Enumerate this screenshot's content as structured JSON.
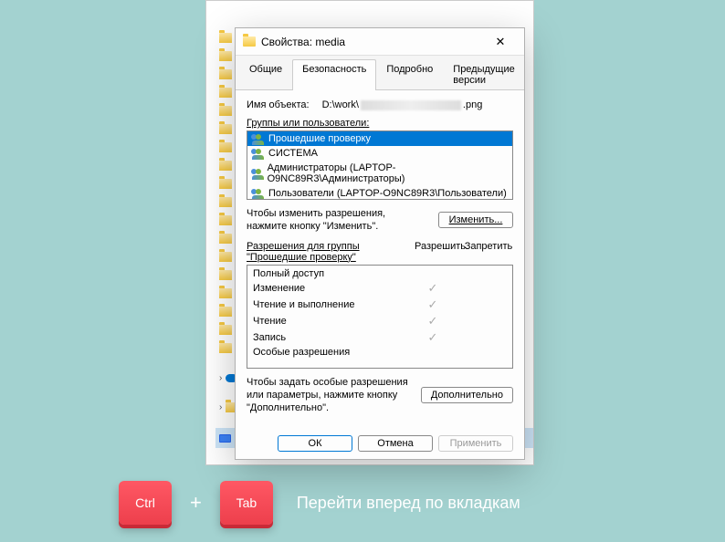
{
  "dialog": {
    "title": "Свойства: media",
    "tabs": [
      "Общие",
      "Безопасность",
      "Подробно",
      "Предыдущие версии"
    ],
    "active_tab": 1,
    "object_label": "Имя объекта:",
    "object_path_prefix": "D:\\work\\",
    "object_path_suffix": ".png",
    "groups_label": "Группы или пользователи:",
    "groups": [
      "Прошедшие проверку",
      "СИСТЕМА",
      "Администраторы (LAPTOP-O9NC89R3\\Администраторы)",
      "Пользователи (LAPTOP-O9NC89R3\\Пользователи)"
    ],
    "selected_group": 0,
    "change_help": "Чтобы изменить разрешения,\nнажмите кнопку \"Изменить\".",
    "change_btn": "Изменить...",
    "perm_header": "Разрешения для группы \"Прошедшие проверку\"",
    "perm_allow": "Разрешить",
    "perm_deny": "Запретить",
    "permissions": [
      {
        "name": "Полный доступ",
        "allow": false,
        "deny": false
      },
      {
        "name": "Изменение",
        "allow": true,
        "deny": false
      },
      {
        "name": "Чтение и выполнение",
        "allow": true,
        "deny": false
      },
      {
        "name": "Чтение",
        "allow": true,
        "deny": false
      },
      {
        "name": "Запись",
        "allow": true,
        "deny": false
      },
      {
        "name": "Особые разрешения",
        "allow": false,
        "deny": false
      }
    ],
    "advanced_help": "Чтобы задать особые разрешения или параметры, нажмите кнопку \"Дополнительно\".",
    "advanced_btn": "Дополнительно",
    "ok_btn": "ОК",
    "cancel_btn": "Отмена",
    "apply_btn": "Применить"
  },
  "shortcut": {
    "key1": "Ctrl",
    "key2": "Tab",
    "desc": "Перейти вперед по вкладкам"
  }
}
